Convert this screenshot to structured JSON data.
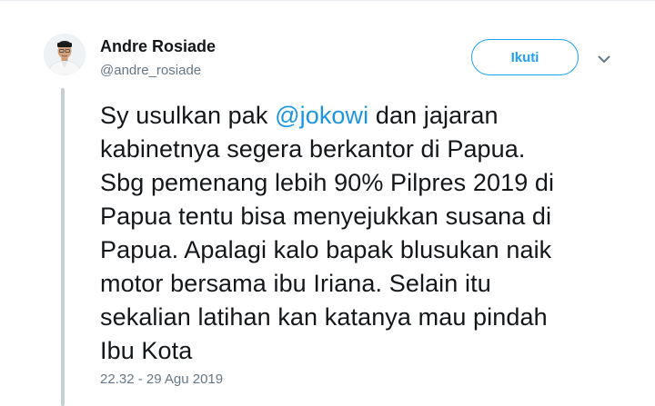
{
  "user": {
    "name": "Andre Rosiade",
    "handle": "@andre_rosiade"
  },
  "actions": {
    "follow_label": "Ikuti",
    "menu_icon": "chevron-down-icon"
  },
  "tweet": {
    "line1_before": "Sy usulkan pak ",
    "mention": "@jokowi",
    "line1_after": " dan jajaran",
    "lines": [
      "kabinetnya segera berkantor di Papua.",
      "Sbg pemenang lebih 90% Pilpres 2019 di",
      "Papua tentu bisa menyejukkan susana di",
      "Papua. Apalagi kalo bapak blusukan naik",
      "motor bersama ibu Iriana. Selain itu",
      "sekalian latihan kan katanya mau pindah",
      "Ibu Kota"
    ],
    "timestamp": "22.32 - 29 Agu 2019"
  },
  "colors": {
    "accent": "#1da1f2",
    "mention": "#1b95e0",
    "text": "#14171a",
    "muted": "#657786",
    "thread_line": "#c4cfd6"
  }
}
